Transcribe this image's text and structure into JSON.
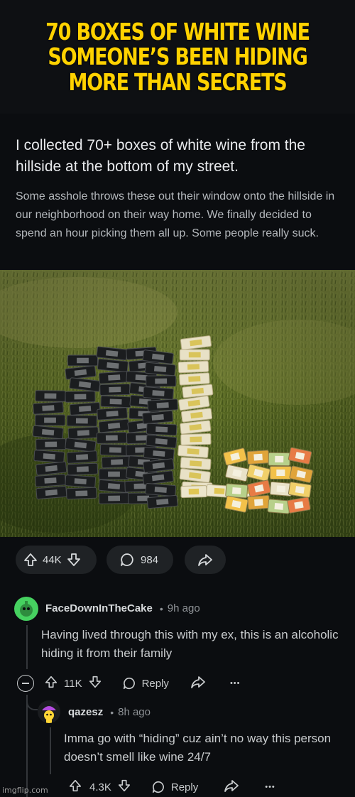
{
  "meme": {
    "caption": "70 BOXES OF WHITE WINE SOMEONE’S BEEN HIDING MORE THAN SECRETS"
  },
  "post": {
    "title": "I collected 70+ boxes of white wine from the hillside at the bottom of my street.",
    "body": "Some asshole throws these out their window onto the hillside in our neighborhood on their way home. We finally decided to spend an hour picking them all up. Some people really suck.",
    "upvotes": "44K",
    "comments": "984"
  },
  "comments": [
    {
      "username": "FaceDownInTheCake",
      "separator": "•",
      "time": "9h ago",
      "text": "Having lived through this with my ex, this is an alcoholic hiding it from their family",
      "votes": "11K",
      "reply_label": "Reply",
      "more_label": "•••",
      "avatar_color": "#46d160"
    },
    {
      "username": "qazesz",
      "separator": "•",
      "time": "8h ago",
      "text": "Imma go with “hiding” cuz ain’t no way this person doesn’t smell like wine 24/7",
      "votes": "4.3K",
      "reply_label": "Reply",
      "more_label": "•••",
      "avatar_color": "#ffd635"
    }
  ],
  "watermark": "imgflip.com",
  "colors": {
    "caption": "#ffd200",
    "background": "#0b0d10",
    "pill": "#1f2225"
  }
}
